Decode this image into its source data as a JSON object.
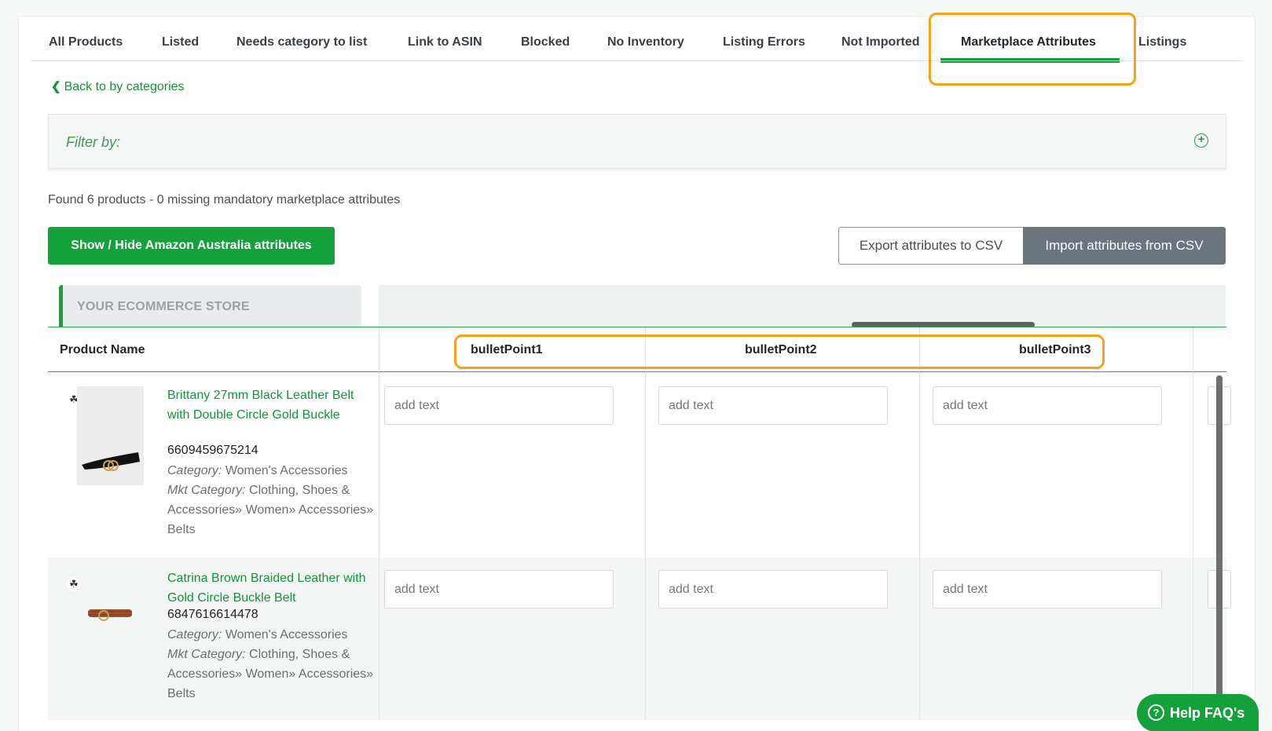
{
  "tabs": [
    {
      "label": "All Products"
    },
    {
      "label": "Listed"
    },
    {
      "label": "Needs category to list"
    },
    {
      "label": "Link to ASIN"
    },
    {
      "label": "Blocked"
    },
    {
      "label": "No Inventory"
    },
    {
      "label": "Listing Errors"
    },
    {
      "label": "Not Imported"
    },
    {
      "label": "Marketplace Attributes"
    },
    {
      "label": "Listings"
    }
  ],
  "active_tab": "Marketplace Attributes",
  "back_link": "Back to by categories",
  "filter": {
    "label": "Filter by:"
  },
  "found_text": "Found 6 products - 0 missing mandatory marketplace attributes",
  "buttons": {
    "toggle_attrs": "Show / Hide Amazon Australia attributes",
    "export_csv": "Export attributes to CSV",
    "import_csv": "Import attributes from CSV"
  },
  "store_tab": "YOUR ECOMMERCE STORE",
  "columns": {
    "product_name": "Product Name",
    "attributes": [
      "bulletPoint1",
      "bulletPoint2",
      "bulletPoint3"
    ]
  },
  "input_placeholder": "add text",
  "products": [
    {
      "name": "Brittany 27mm Black Leather Belt with Double Circle Gold Buckle",
      "id": "6609459675214",
      "category_label": "Category:",
      "category": "Women's Accessories",
      "mkt_category_label": "Mkt Category:",
      "mkt_category": "Clothing, Shoes & Accessories» Women» Accessories» Belts"
    },
    {
      "name": "Catrina Brown Braided Leather with Gold Circle Buckle Belt",
      "id": "6847616614478",
      "category_label": "Category:",
      "category": "Women's Accessories",
      "mkt_category_label": "Mkt Category:",
      "mkt_category": "Clothing, Shoes & Accessories» Women» Accessories» Belts"
    }
  ],
  "help_button": "Help FAQ's",
  "colors": {
    "accent": "#14a03a",
    "highlight": "#f5a31a",
    "secondary": "#6c757d"
  }
}
